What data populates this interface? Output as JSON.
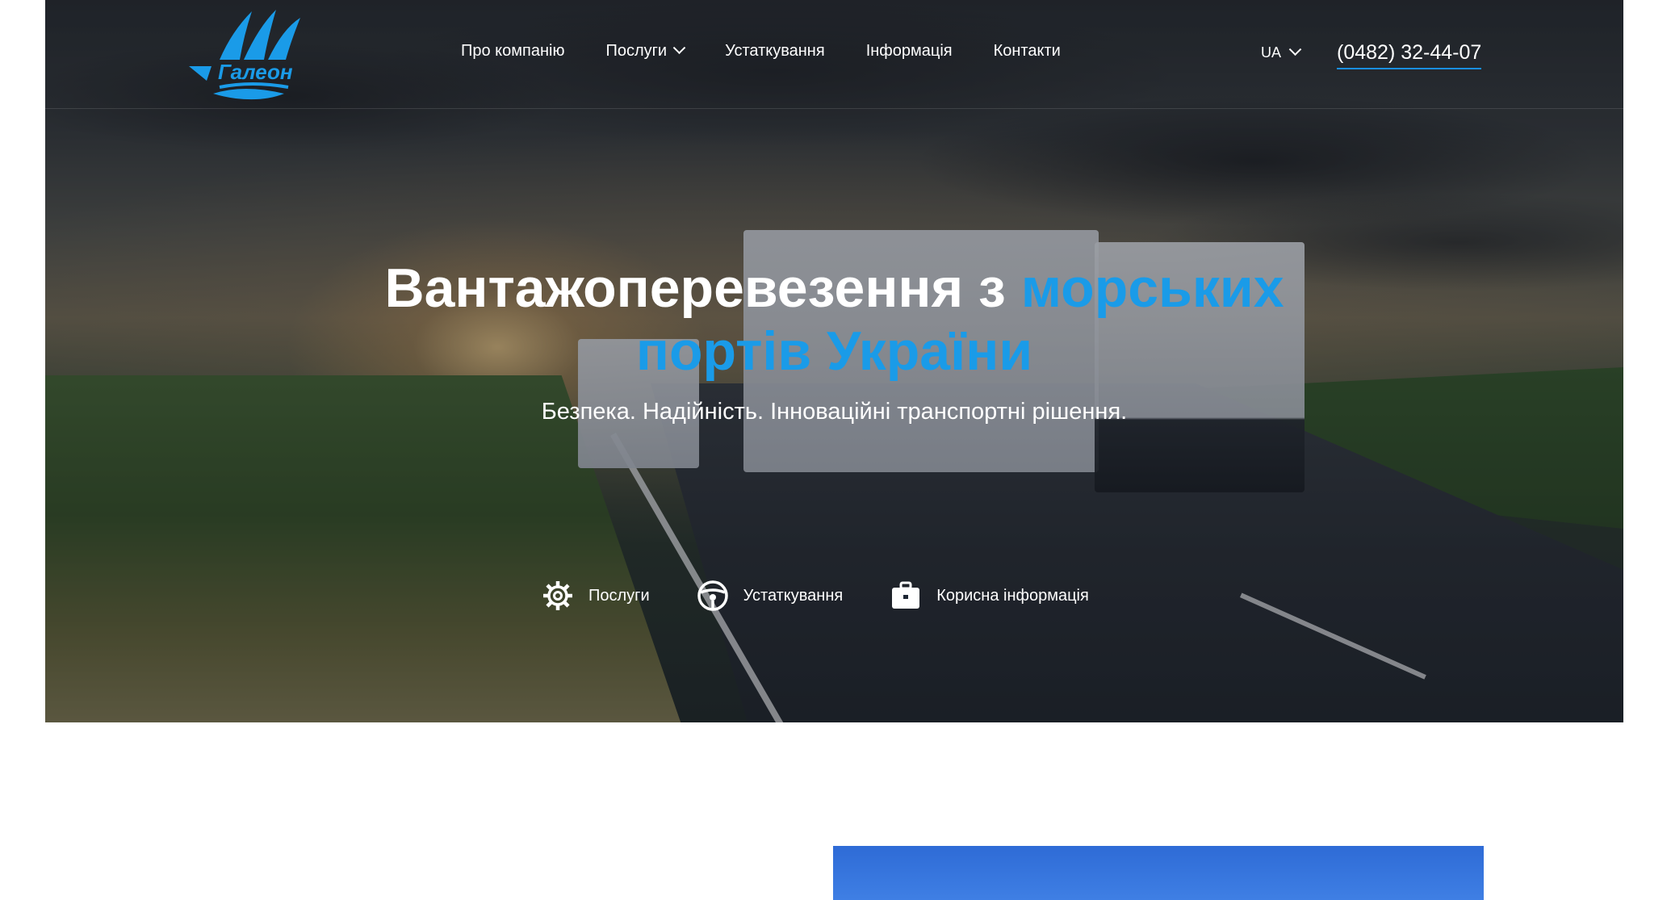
{
  "brand": {
    "logo_text": "Галеон",
    "accent_color": "#1a9be8"
  },
  "nav": {
    "items": [
      {
        "label": "Про компанію",
        "has_dropdown": false
      },
      {
        "label": "Послуги",
        "has_dropdown": true
      },
      {
        "label": "Устаткування",
        "has_dropdown": false
      },
      {
        "label": "Інформація",
        "has_dropdown": false
      },
      {
        "label": "Контакти",
        "has_dropdown": false
      }
    ],
    "language": "UA",
    "phone": "(0482) 32-44-07"
  },
  "hero": {
    "title_white": "Вантажоперевезення з ",
    "title_blue_1": "морських",
    "title_blue_2": "портів України",
    "subtitle": "Безпека. Надійність. Інноваційні транспортні рішення.",
    "quick_links": [
      {
        "label": "Послуги",
        "icon": "gear-icon"
      },
      {
        "label": "Устаткування",
        "icon": "steering-wheel-icon"
      },
      {
        "label": "Корисна інформація",
        "icon": "briefcase-icon"
      }
    ]
  }
}
